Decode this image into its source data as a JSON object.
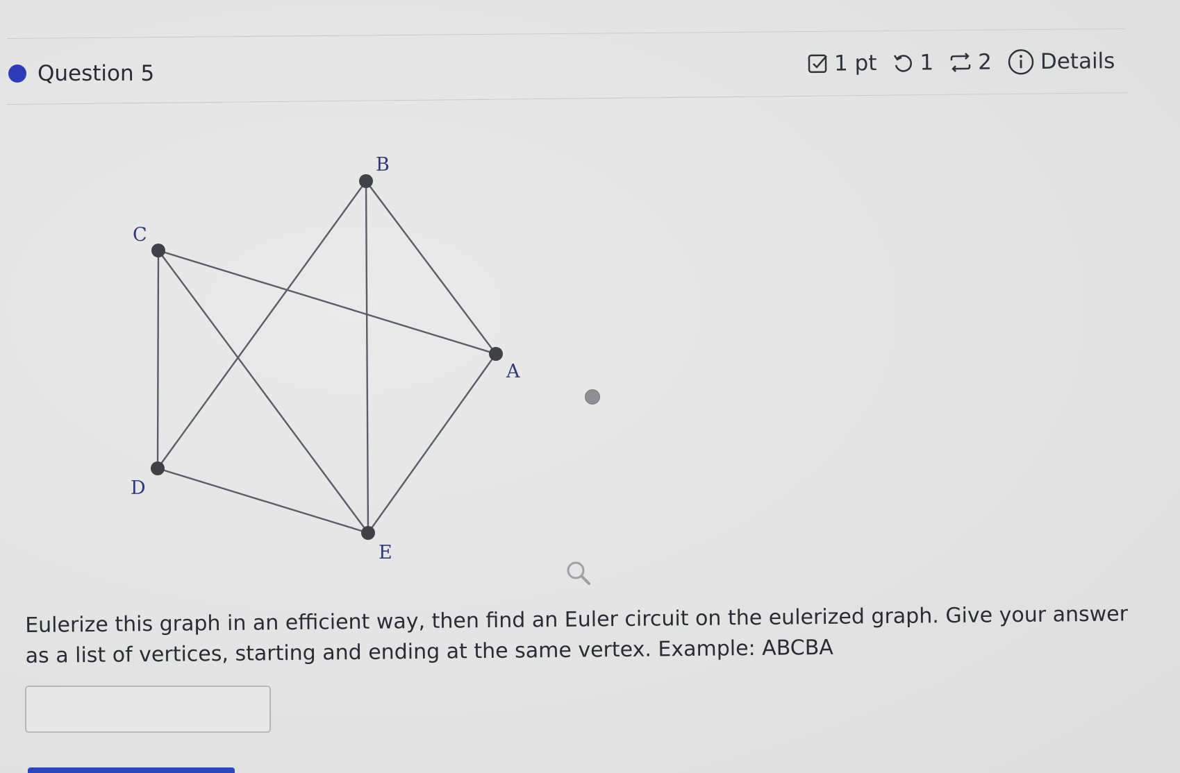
{
  "question": {
    "title": "Question 5"
  },
  "meta": {
    "points": "1 pt",
    "attempts": "1",
    "versions": "2",
    "details_label": "Details"
  },
  "graph": {
    "vertices": {
      "A": "A",
      "B": "B",
      "C": "C",
      "D": "D",
      "E": "E"
    },
    "edges": [
      [
        "C",
        "A"
      ],
      [
        "C",
        "D"
      ],
      [
        "C",
        "E"
      ],
      [
        "D",
        "B"
      ],
      [
        "D",
        "E"
      ],
      [
        "B",
        "E"
      ],
      [
        "B",
        "A"
      ],
      [
        "A",
        "E"
      ]
    ]
  },
  "prompt": {
    "text": "Eulerize this graph in an efficient way, then find an Euler circuit on the eulerized graph. Give your answer as a list of vertices, starting and ending at the same vertex. Example: ABCBA"
  },
  "answer": {
    "value": "",
    "placeholder": ""
  },
  "colors": {
    "accent": "#2e3cb8",
    "edge": "#5a5d66",
    "vertex": "#3f4147",
    "label": "#2f3a7a"
  },
  "icons": [
    "checkbox-icon",
    "retry-icon",
    "versions-icon",
    "info-icon",
    "zoom-icon"
  ]
}
